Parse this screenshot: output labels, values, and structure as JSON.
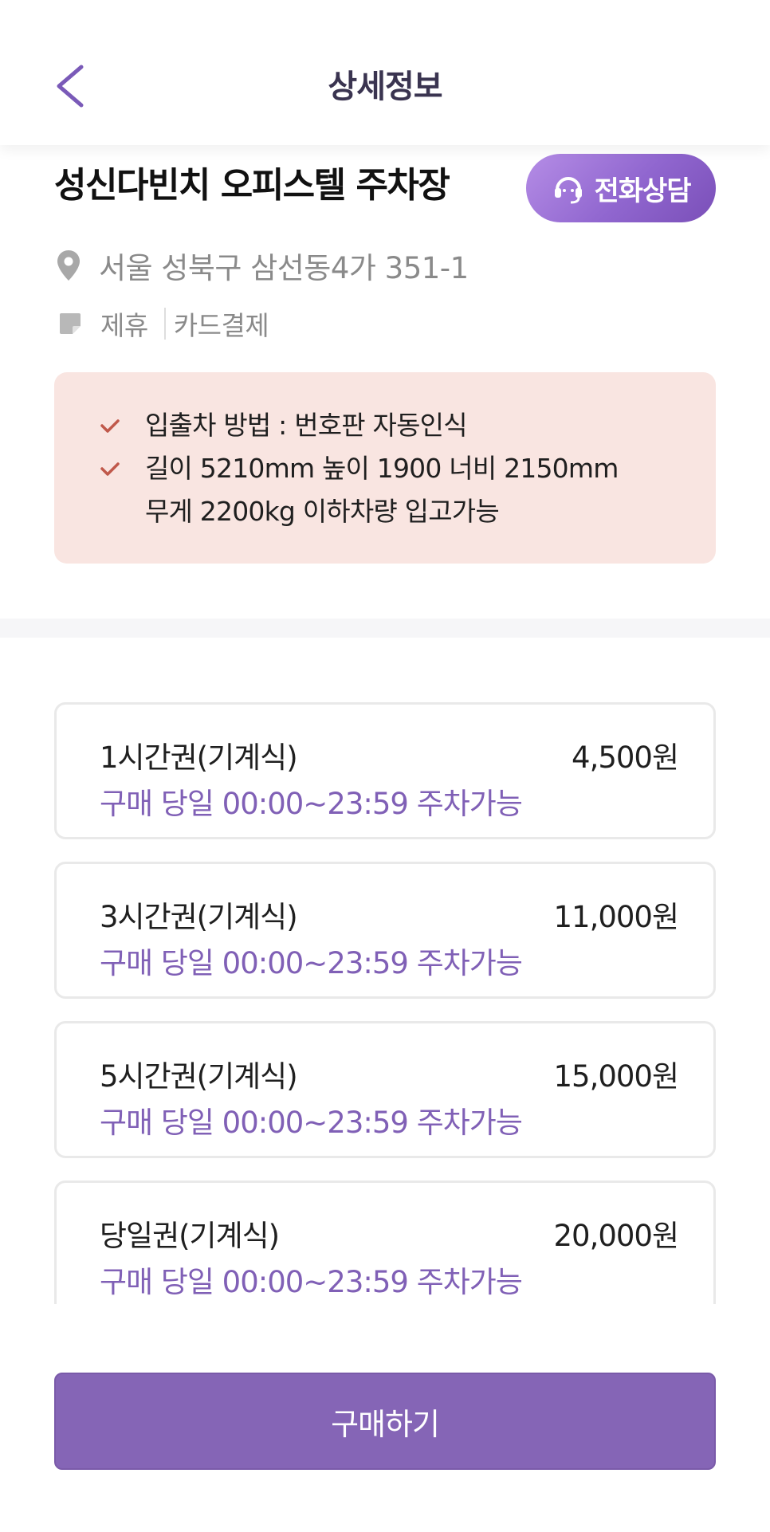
{
  "header": {
    "title": "상세정보",
    "back_icon": "chevron-left-icon"
  },
  "lot": {
    "name": "성신다빈치 오피스텔 주차장",
    "call_button": {
      "label": "전화상담",
      "icon": "headset-icon"
    },
    "address": "서울 성북구 삼선동4가 351-1",
    "address_icon": "location-pin-icon",
    "tags_icon": "note-icon",
    "tags": [
      "제휴",
      "카드결제"
    ]
  },
  "notice": {
    "items": [
      "입출차 방법 : 번호판 자동인식",
      "길이 5210mm 높이 1900 너비 2150mm",
      "무게 2200kg 이하차량 입고가능"
    ]
  },
  "tickets": [
    {
      "name": "1시간권(기계식)",
      "price": "4,500원",
      "desc": "구매 당일 00:00~23:59 주차가능"
    },
    {
      "name": "3시간권(기계식)",
      "price": "11,000원",
      "desc": "구매 당일 00:00~23:59 주차가능"
    },
    {
      "name": "5시간권(기계식)",
      "price": "15,000원",
      "desc": "구매 당일 00:00~23:59 주차가능"
    },
    {
      "name": "당일권(기계식)",
      "price": "20,000원",
      "desc": "구매 당일 00:00~23:59 주차가능"
    }
  ],
  "buy_button": {
    "label": "구매하기"
  },
  "colors": {
    "accent": "#8565b6",
    "accent_text": "#8060b6",
    "notice_bg": "#f9e5e1",
    "check": "#c0584a"
  }
}
